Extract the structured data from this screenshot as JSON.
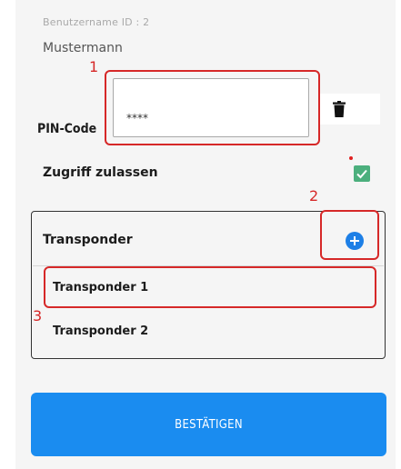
{
  "user": {
    "label": "Benutzername  ID : 2",
    "name": "Mustermann"
  },
  "pin": {
    "label": "PIN-Code",
    "value": "****"
  },
  "access": {
    "label": "Zugriff zulassen",
    "checked": true
  },
  "transponder": {
    "title": "Transponder",
    "items": [
      {
        "label": "Transponder 1"
      },
      {
        "label": "Transponder 2"
      }
    ]
  },
  "confirm_label": "BESTÄTIGEN",
  "annotations": [
    "1",
    "2",
    "3"
  ],
  "icons": {
    "trash": "trash-icon",
    "add": "plus-circle-icon",
    "check": "checkmark-icon"
  },
  "colors": {
    "accent": "#1a8cf0",
    "checkbox": "#4caf7d",
    "annotation": "#d62828"
  }
}
